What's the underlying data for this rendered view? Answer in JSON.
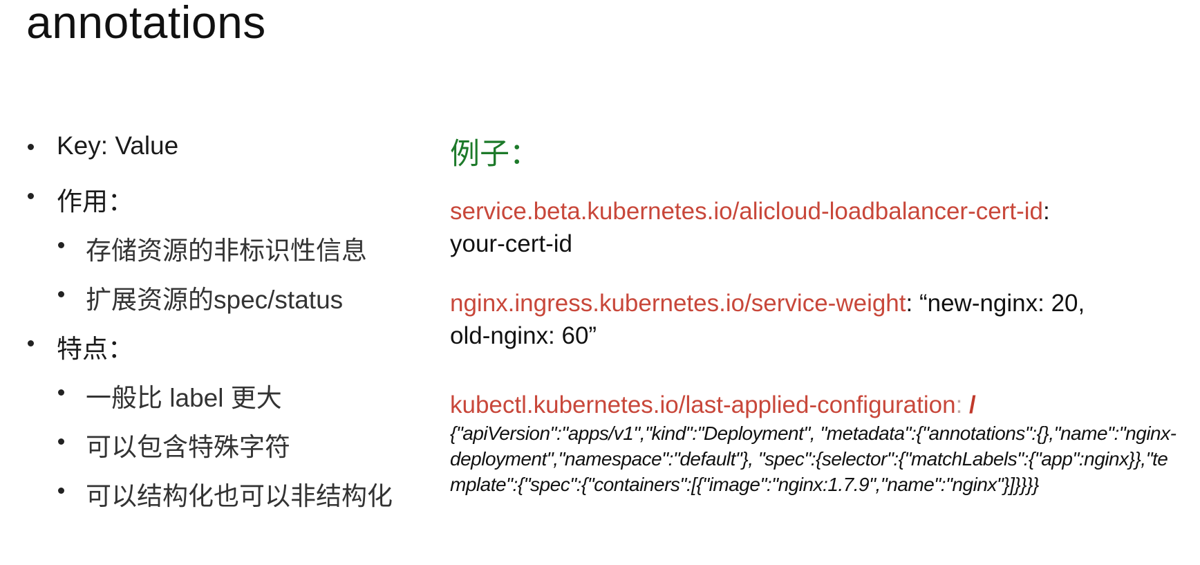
{
  "title": "annotations",
  "left": {
    "items": [
      {
        "level": 1,
        "text": "Key: Value"
      },
      {
        "level": 1,
        "text": "作用："
      },
      {
        "level": 2,
        "text": "存储资源的非标识性信息"
      },
      {
        "level": 2,
        "text": "扩展资源的spec/status"
      },
      {
        "level": 1,
        "text": "特点："
      },
      {
        "level": 2,
        "text": "一般比 label 更大"
      },
      {
        "level": 2,
        "text": "可以包含特殊字符"
      },
      {
        "level": 2,
        "text": "可以结构化也可以非结构化"
      }
    ]
  },
  "right": {
    "example_label": "例子：",
    "ex1": {
      "key": "service.beta.kubernetes.io/alicloud-loadbalancer-cert-id",
      "sep": ":",
      "value": "your-cert-id"
    },
    "ex2": {
      "key": "nginx.ingress.kubernetes.io/service-weight",
      "sep": ": ",
      "value_line1": "“new-nginx: 20,",
      "value_line2": "old-nginx: 60”"
    },
    "ex3": {
      "key": "kubectl.kubernetes.io/last-applied-configuration",
      "sep": ": ",
      "slash": "/",
      "json": "{\"apiVersion\":\"apps/v1\",\"kind\":\"Deployment\", \"metadata\":{\"annotations\":{},\"name\":\"nginx-deployment\",\"namespace\":\"default\"}, \"spec\":{selector\":{\"matchLabels\":{\"app\":nginx}},\"template\":{\"spec\":{\"containers\":[{\"image\":\"nginx:1.7.9\",\"name\":\"nginx\"}]}}}}"
    }
  },
  "colors": {
    "key_red": "#c8473a",
    "example_green": "#1d7a2a",
    "text": "#111111"
  }
}
